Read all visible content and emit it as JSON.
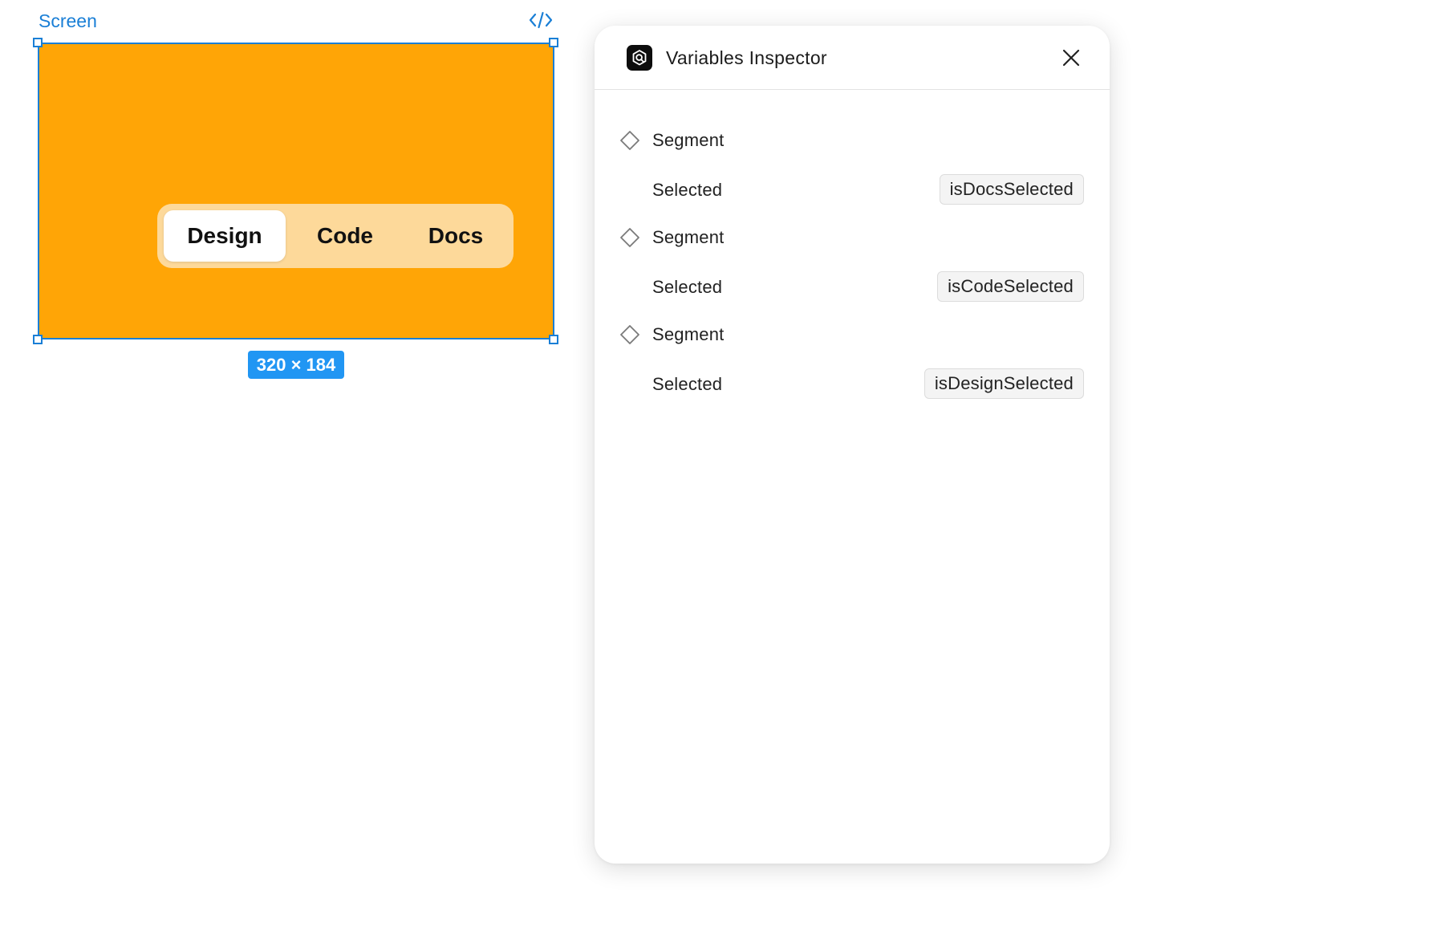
{
  "canvas": {
    "frame_label": "Screen",
    "size_badge": "320 × 184",
    "frame_color": "#ffa506",
    "segments": [
      {
        "label": "Design",
        "selected": true
      },
      {
        "label": "Code",
        "selected": false
      },
      {
        "label": "Docs",
        "selected": false
      }
    ]
  },
  "inspector": {
    "title": "Variables Inspector",
    "rows": [
      {
        "type": "component",
        "label": "Segment",
        "icon": "diamond-icon"
      },
      {
        "type": "property",
        "label": "Selected",
        "variable": "isDocsSelected"
      },
      {
        "type": "component",
        "label": "Segment",
        "icon": "diamond-icon"
      },
      {
        "type": "property",
        "label": "Selected",
        "variable": "isCodeSelected"
      },
      {
        "type": "component",
        "label": "Segment",
        "icon": "diamond-icon"
      },
      {
        "type": "property",
        "label": "Selected",
        "variable": "isDesignSelected"
      }
    ]
  },
  "colors": {
    "accent": "#1a7fd6",
    "badge": "#2196f3"
  }
}
